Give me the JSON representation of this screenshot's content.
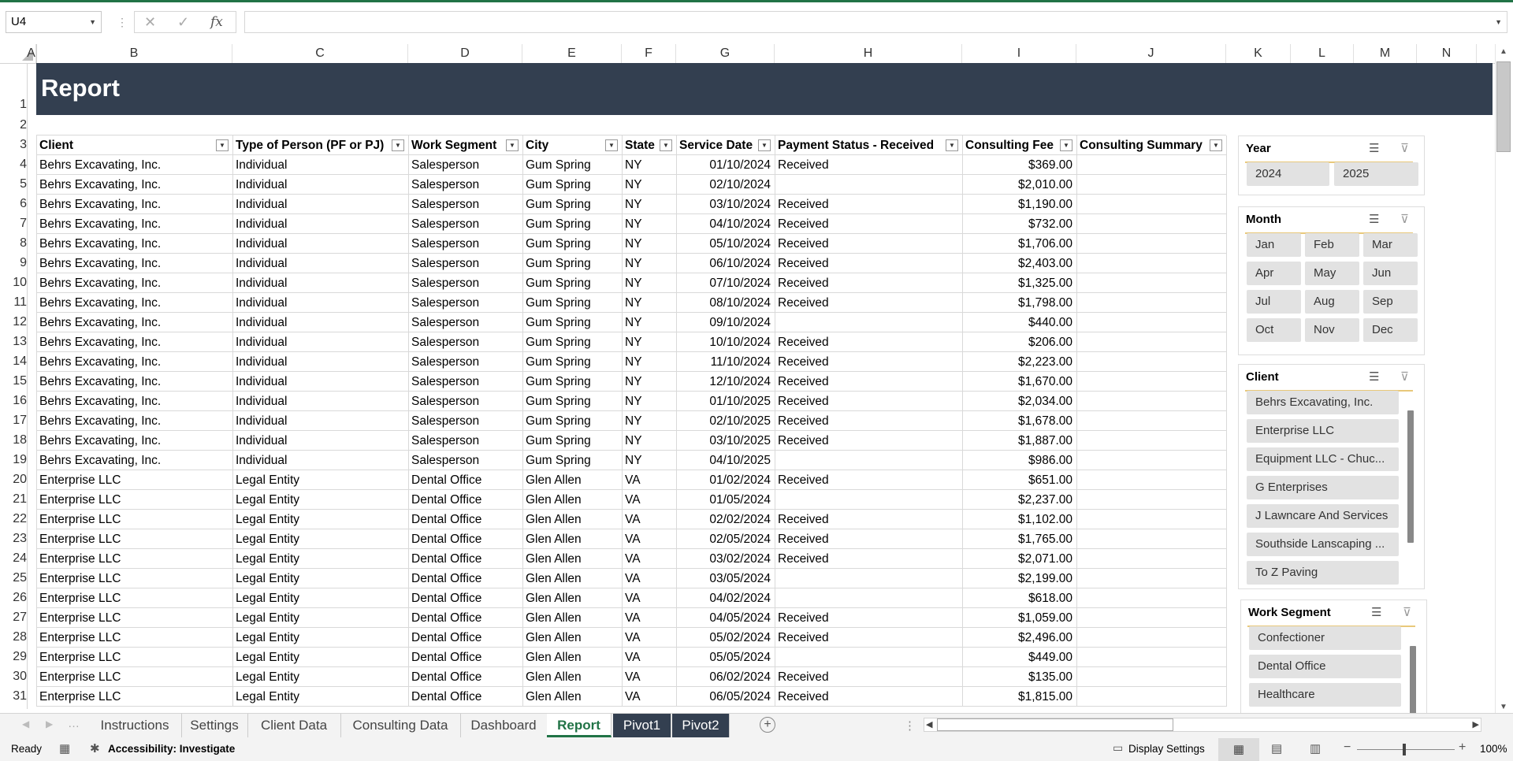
{
  "name_box": "U4",
  "formula": "",
  "columns": [
    "A",
    "B",
    "C",
    "D",
    "E",
    "F",
    "G",
    "H",
    "I",
    "J",
    "K",
    "L",
    "M",
    "N"
  ],
  "rows": [
    "1",
    "2",
    "3",
    "4",
    "5",
    "6",
    "7",
    "8",
    "9",
    "10",
    "11",
    "12",
    "13",
    "14",
    "15",
    "16",
    "17",
    "18",
    "19",
    "20",
    "21",
    "22",
    "23",
    "24",
    "25",
    "26",
    "27",
    "28",
    "29",
    "30",
    "31"
  ],
  "report_title": "Report",
  "table": {
    "headers": [
      "Client",
      "Type of Person (PF or PJ)",
      "Work Segment",
      "City",
      "State",
      "Service Date",
      "Payment Status - Received",
      "Consulting Fee",
      "Consulting Summary"
    ],
    "rows": [
      [
        "Behrs Excavating, Inc.",
        "Individual",
        "Salesperson",
        "Gum Spring",
        "NY",
        "01/10/2024",
        "Received",
        "$369.00",
        ""
      ],
      [
        "Behrs Excavating, Inc.",
        "Individual",
        "Salesperson",
        "Gum Spring",
        "NY",
        "02/10/2024",
        "",
        "$2,010.00",
        ""
      ],
      [
        "Behrs Excavating, Inc.",
        "Individual",
        "Salesperson",
        "Gum Spring",
        "NY",
        "03/10/2024",
        "Received",
        "$1,190.00",
        ""
      ],
      [
        "Behrs Excavating, Inc.",
        "Individual",
        "Salesperson",
        "Gum Spring",
        "NY",
        "04/10/2024",
        "Received",
        "$732.00",
        ""
      ],
      [
        "Behrs Excavating, Inc.",
        "Individual",
        "Salesperson",
        "Gum Spring",
        "NY",
        "05/10/2024",
        "Received",
        "$1,706.00",
        ""
      ],
      [
        "Behrs Excavating, Inc.",
        "Individual",
        "Salesperson",
        "Gum Spring",
        "NY",
        "06/10/2024",
        "Received",
        "$2,403.00",
        ""
      ],
      [
        "Behrs Excavating, Inc.",
        "Individual",
        "Salesperson",
        "Gum Spring",
        "NY",
        "07/10/2024",
        "Received",
        "$1,325.00",
        ""
      ],
      [
        "Behrs Excavating, Inc.",
        "Individual",
        "Salesperson",
        "Gum Spring",
        "NY",
        "08/10/2024",
        "Received",
        "$1,798.00",
        ""
      ],
      [
        "Behrs Excavating, Inc.",
        "Individual",
        "Salesperson",
        "Gum Spring",
        "NY",
        "09/10/2024",
        "",
        "$440.00",
        ""
      ],
      [
        "Behrs Excavating, Inc.",
        "Individual",
        "Salesperson",
        "Gum Spring",
        "NY",
        "10/10/2024",
        "Received",
        "$206.00",
        ""
      ],
      [
        "Behrs Excavating, Inc.",
        "Individual",
        "Salesperson",
        "Gum Spring",
        "NY",
        "11/10/2024",
        "Received",
        "$2,223.00",
        ""
      ],
      [
        "Behrs Excavating, Inc.",
        "Individual",
        "Salesperson",
        "Gum Spring",
        "NY",
        "12/10/2024",
        "Received",
        "$1,670.00",
        ""
      ],
      [
        "Behrs Excavating, Inc.",
        "Individual",
        "Salesperson",
        "Gum Spring",
        "NY",
        "01/10/2025",
        "Received",
        "$2,034.00",
        ""
      ],
      [
        "Behrs Excavating, Inc.",
        "Individual",
        "Salesperson",
        "Gum Spring",
        "NY",
        "02/10/2025",
        "Received",
        "$1,678.00",
        ""
      ],
      [
        "Behrs Excavating, Inc.",
        "Individual",
        "Salesperson",
        "Gum Spring",
        "NY",
        "03/10/2025",
        "Received",
        "$1,887.00",
        ""
      ],
      [
        "Behrs Excavating, Inc.",
        "Individual",
        "Salesperson",
        "Gum Spring",
        "NY",
        "04/10/2025",
        "",
        "$986.00",
        ""
      ],
      [
        "Enterprise LLC",
        "Legal Entity",
        "Dental Office",
        "Glen Allen",
        "VA",
        "01/02/2024",
        "Received",
        "$651.00",
        ""
      ],
      [
        "Enterprise LLC",
        "Legal Entity",
        "Dental Office",
        "Glen Allen",
        "VA",
        "01/05/2024",
        "",
        "$2,237.00",
        ""
      ],
      [
        "Enterprise LLC",
        "Legal Entity",
        "Dental Office",
        "Glen Allen",
        "VA",
        "02/02/2024",
        "Received",
        "$1,102.00",
        ""
      ],
      [
        "Enterprise LLC",
        "Legal Entity",
        "Dental Office",
        "Glen Allen",
        "VA",
        "02/05/2024",
        "Received",
        "$1,765.00",
        ""
      ],
      [
        "Enterprise LLC",
        "Legal Entity",
        "Dental Office",
        "Glen Allen",
        "VA",
        "03/02/2024",
        "Received",
        "$2,071.00",
        ""
      ],
      [
        "Enterprise LLC",
        "Legal Entity",
        "Dental Office",
        "Glen Allen",
        "VA",
        "03/05/2024",
        "",
        "$2,199.00",
        ""
      ],
      [
        "Enterprise LLC",
        "Legal Entity",
        "Dental Office",
        "Glen Allen",
        "VA",
        "04/02/2024",
        "",
        "$618.00",
        ""
      ],
      [
        "Enterprise LLC",
        "Legal Entity",
        "Dental Office",
        "Glen Allen",
        "VA",
        "04/05/2024",
        "Received",
        "$1,059.00",
        ""
      ],
      [
        "Enterprise LLC",
        "Legal Entity",
        "Dental Office",
        "Glen Allen",
        "VA",
        "05/02/2024",
        "Received",
        "$2,496.00",
        ""
      ],
      [
        "Enterprise LLC",
        "Legal Entity",
        "Dental Office",
        "Glen Allen",
        "VA",
        "05/05/2024",
        "",
        "$449.00",
        ""
      ],
      [
        "Enterprise LLC",
        "Legal Entity",
        "Dental Office",
        "Glen Allen",
        "VA",
        "06/02/2024",
        "Received",
        "$135.00",
        ""
      ],
      [
        "Enterprise LLC",
        "Legal Entity",
        "Dental Office",
        "Glen Allen",
        "VA",
        "06/05/2024",
        "Received",
        "$1,815.00",
        ""
      ]
    ]
  },
  "slicers": {
    "year": {
      "title": "Year",
      "items": [
        "2024",
        "2025"
      ]
    },
    "month": {
      "title": "Month",
      "items": [
        "Jan",
        "Feb",
        "Mar",
        "Apr",
        "May",
        "Jun",
        "Jul",
        "Aug",
        "Sep",
        "Oct",
        "Nov",
        "Dec"
      ]
    },
    "client": {
      "title": "Client",
      "items": [
        "Behrs Excavating, Inc.",
        "Enterprise LLC",
        "Equipment LLC - Chuc...",
        "G Enterprises",
        "J Lawncare And Services",
        "Southside Lanscaping ...",
        "To Z Paving"
      ]
    },
    "work_segment": {
      "title": "Work Segment",
      "items": [
        "Confectioner",
        "Dental Office",
        "Healthcare"
      ]
    }
  },
  "sheet_tabs": [
    "Instructions",
    "Settings",
    "Client Data",
    "Consulting Data",
    "Dashboard",
    "Report",
    "Pivot1",
    "Pivot2"
  ],
  "active_tab": "Report",
  "status": {
    "ready": "Ready",
    "accessibility": "Accessibility: Investigate",
    "display_settings": "Display Settings",
    "zoom": "100%"
  },
  "colors": {
    "accent": "#217346",
    "banner": "#333f50",
    "slicer_button": "#e2e2e2"
  }
}
